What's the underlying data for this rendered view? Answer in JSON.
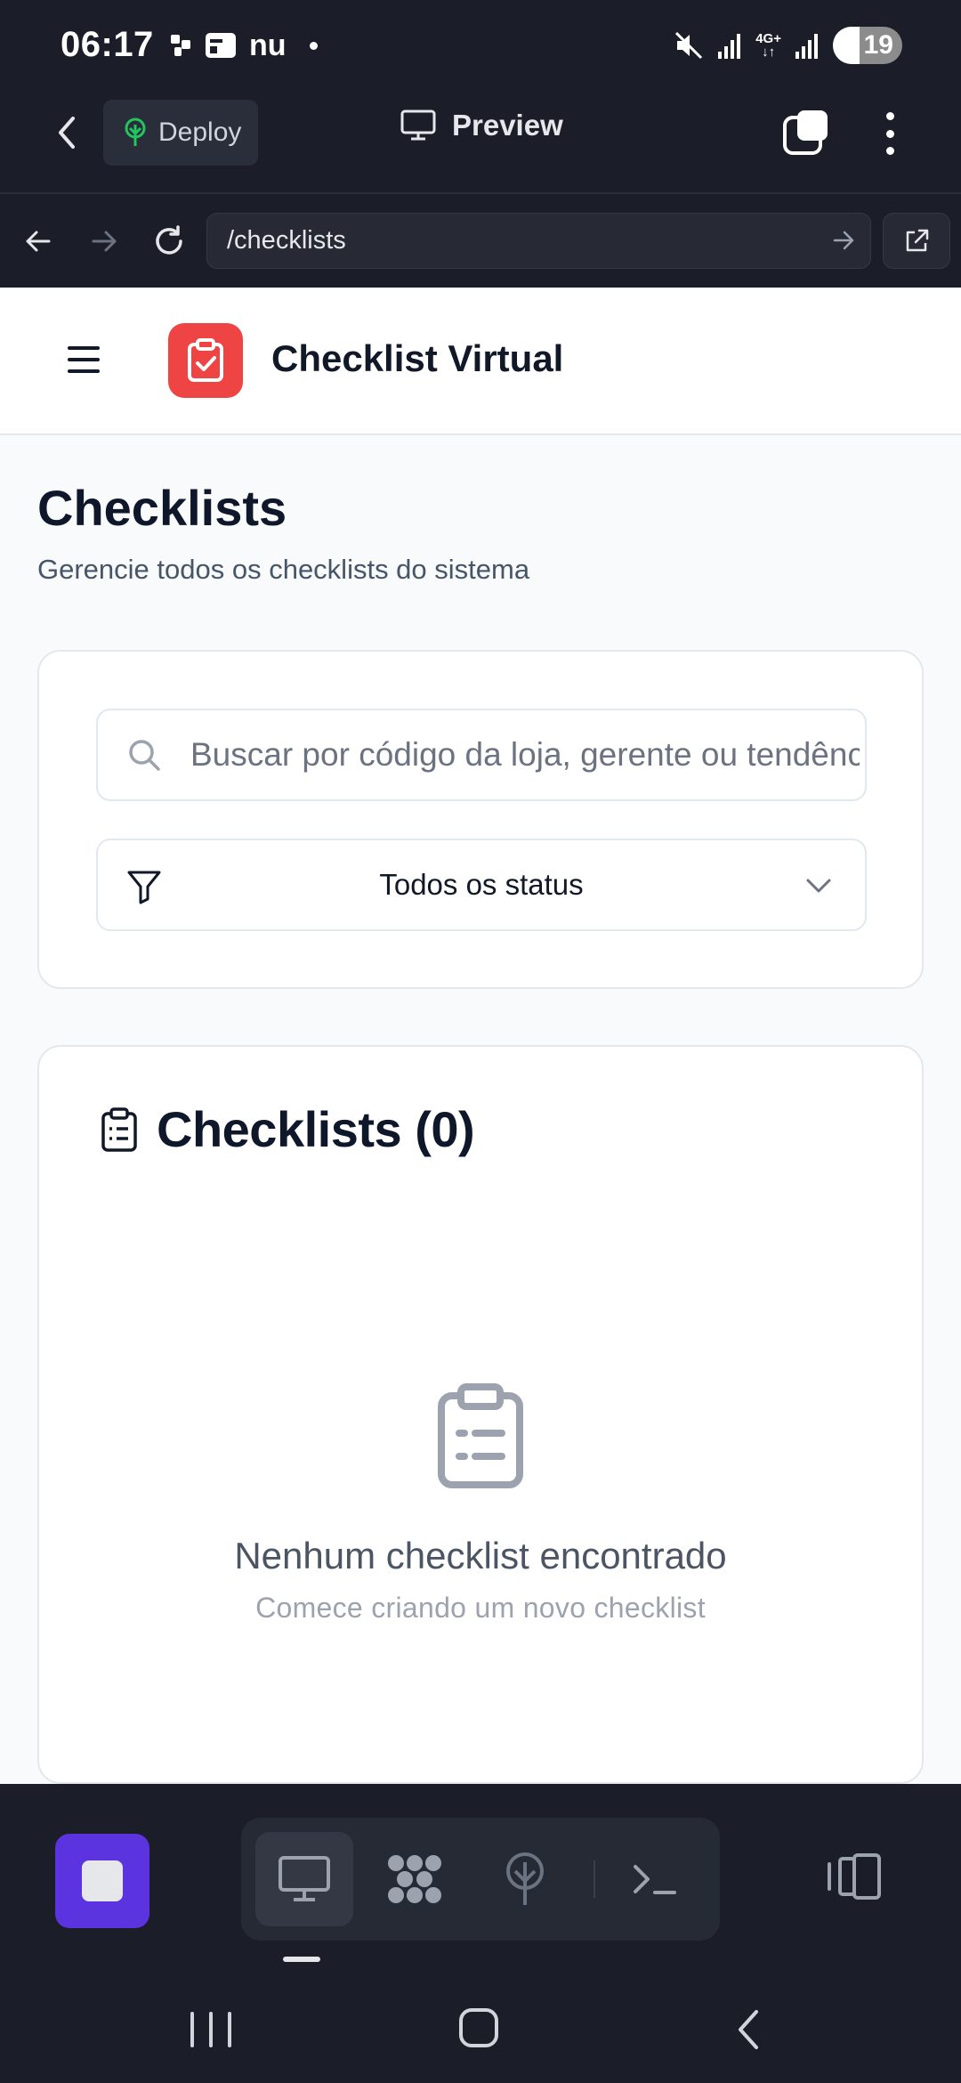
{
  "status_bar": {
    "time": "06:17",
    "left_icons": [
      "teams-icon",
      "wallet-icon",
      "nu-icon",
      "dot-icon"
    ],
    "nu_label": "nu",
    "right_icons": [
      "mute-icon",
      "signal-icon",
      "4g-icon",
      "signal-icon"
    ],
    "network_label": "4G+",
    "battery": "19"
  },
  "app_bar": {
    "deploy_label": "Deploy",
    "preview_label": "Preview"
  },
  "url_bar": {
    "url": "/checklists"
  },
  "site_header": {
    "brand": "Checklist Virtual"
  },
  "page": {
    "title": "Checklists",
    "subtitle": "Gerencie todos os checklists do sistema"
  },
  "filters": {
    "search_placeholder": "Buscar por código da loja, gerente ou tendência...",
    "search_value": "",
    "status_selected": "Todos os status"
  },
  "list": {
    "title": "Checklists (0)",
    "empty_title": "Nenhum checklist encontrado",
    "empty_subtitle": "Comece criando um novo checklist"
  },
  "colors": {
    "dark_chrome": "#1b1e29",
    "logo_red": "#ef4444",
    "stop_purple": "#5b34e0",
    "page_bg": "#f8fafc"
  }
}
